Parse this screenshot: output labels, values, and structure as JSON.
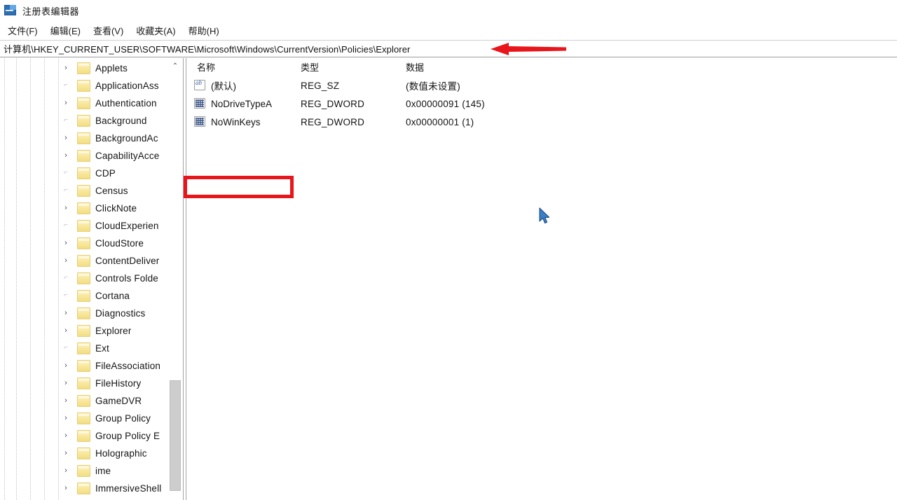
{
  "window": {
    "title": "注册表编辑器",
    "icon": "registry-editor-icon"
  },
  "menubar": {
    "items": [
      {
        "label": "文件(F)"
      },
      {
        "label": "编辑(E)"
      },
      {
        "label": "查看(V)"
      },
      {
        "label": "收藏夹(A)"
      },
      {
        "label": "帮助(H)"
      }
    ]
  },
  "address": {
    "path": "计算机\\HKEY_CURRENT_USER\\SOFTWARE\\Microsoft\\Windows\\CurrentVersion\\Policies\\Explorer"
  },
  "annotations": {
    "arrow_color": "#e8151b",
    "arrow_points_to": "address-bar-path",
    "highlight_color": "#e8151b",
    "highlight_target": "NoWinKeys"
  },
  "tree": {
    "scroll_up_glyph": "⌃",
    "expander_glyph": "›",
    "leaf_glyph": "⌐",
    "items": [
      {
        "label": "Applets",
        "expandable": true
      },
      {
        "label": "ApplicationAss",
        "expandable": false
      },
      {
        "label": "Authentication",
        "expandable": true
      },
      {
        "label": "Background",
        "expandable": false
      },
      {
        "label": "BackgroundAc",
        "expandable": true
      },
      {
        "label": "CapabilityAcce",
        "expandable": true
      },
      {
        "label": "CDP",
        "expandable": false
      },
      {
        "label": "Census",
        "expandable": false
      },
      {
        "label": "ClickNote",
        "expandable": true
      },
      {
        "label": "CloudExperien",
        "expandable": false
      },
      {
        "label": "CloudStore",
        "expandable": true
      },
      {
        "label": "ContentDeliver",
        "expandable": true
      },
      {
        "label": "Controls Folde",
        "expandable": false
      },
      {
        "label": "Cortana",
        "expandable": false
      },
      {
        "label": "Diagnostics",
        "expandable": true
      },
      {
        "label": "Explorer",
        "expandable": true
      },
      {
        "label": "Ext",
        "expandable": false
      },
      {
        "label": "FileAssociation",
        "expandable": true
      },
      {
        "label": "FileHistory",
        "expandable": true
      },
      {
        "label": "GameDVR",
        "expandable": true
      },
      {
        "label": "Group Policy",
        "expandable": true
      },
      {
        "label": "Group Policy E",
        "expandable": true
      },
      {
        "label": "Holographic",
        "expandable": true
      },
      {
        "label": "ime",
        "expandable": true
      },
      {
        "label": "ImmersiveShell",
        "expandable": true
      }
    ]
  },
  "values": {
    "columns": {
      "name": "名称",
      "type": "类型",
      "data": "数据"
    },
    "rows": [
      {
        "icon": "string-value-icon",
        "name": "(默认)",
        "type": "REG_SZ",
        "data": "(数值未设置)",
        "highlighted": false
      },
      {
        "icon": "dword-value-icon",
        "name": "NoDriveTypeA",
        "type": "REG_DWORD",
        "data": "0x00000091 (145)",
        "highlighted": false
      },
      {
        "icon": "dword-value-icon",
        "name": "NoWinKeys",
        "type": "REG_DWORD",
        "data": "0x00000001 (1)",
        "highlighted": true
      }
    ]
  }
}
